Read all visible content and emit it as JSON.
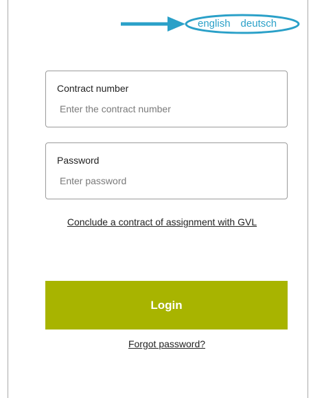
{
  "language_switch": {
    "options": [
      "english",
      "deutsch"
    ]
  },
  "contract_field": {
    "label": "Contract number",
    "placeholder": "Enter the contract number",
    "value": ""
  },
  "password_field": {
    "label": "Password",
    "placeholder": "Enter password",
    "value": ""
  },
  "links": {
    "contract": "Conclude a contract of assignment with GVL",
    "forgot_password": "Forgot password?"
  },
  "login_button": {
    "label": "Login"
  },
  "colors": {
    "accent": "#a8b400",
    "annotation": "#2aa0c8"
  }
}
